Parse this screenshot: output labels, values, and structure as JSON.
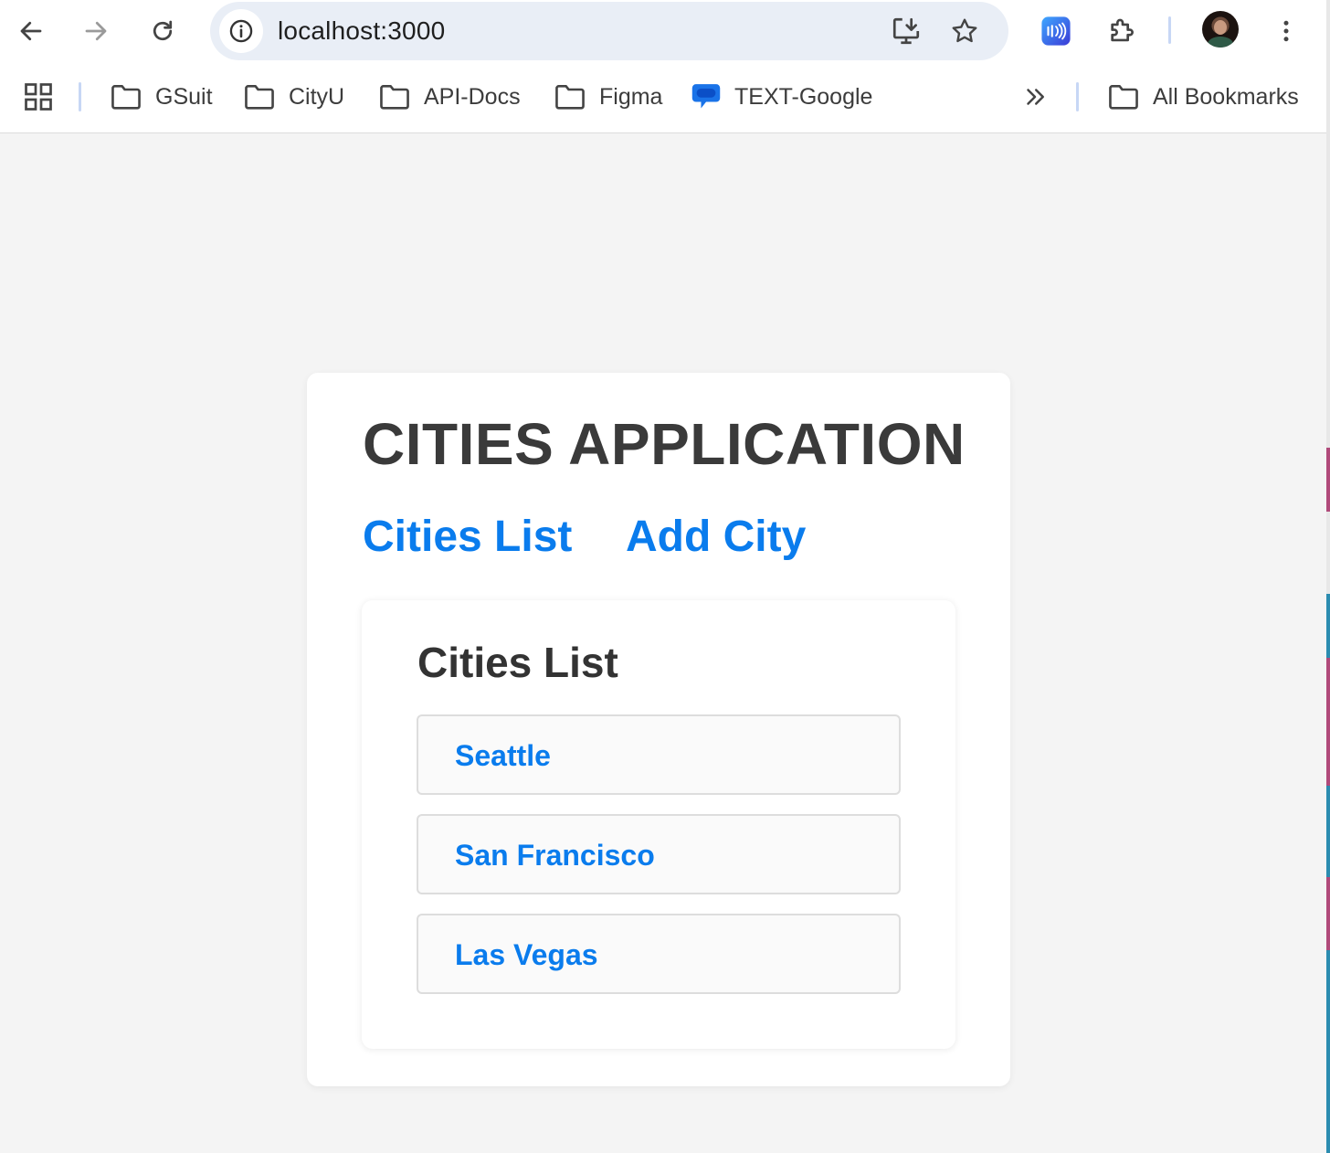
{
  "browser": {
    "url": "localhost:3000",
    "bookmarks": [
      {
        "label": "GSuit",
        "icon": "folder-icon"
      },
      {
        "label": "CityU",
        "icon": "folder-icon"
      },
      {
        "label": "API-Docs",
        "icon": "folder-icon"
      },
      {
        "label": "Figma",
        "icon": "folder-icon"
      },
      {
        "label": "TEXT-Google",
        "icon": "chat-bubble-icon"
      }
    ],
    "all_bookmarks_label": "All Bookmarks",
    "accent_color": "#0b57d0"
  },
  "app": {
    "title": "CITIES APPLICATION",
    "nav": {
      "cities_list": "Cities List",
      "add_city": "Add City"
    },
    "link_color": "#0a7ced",
    "list": {
      "heading": "Cities List",
      "cities": [
        "Seattle",
        "San Francisco",
        "Las Vegas"
      ]
    }
  }
}
